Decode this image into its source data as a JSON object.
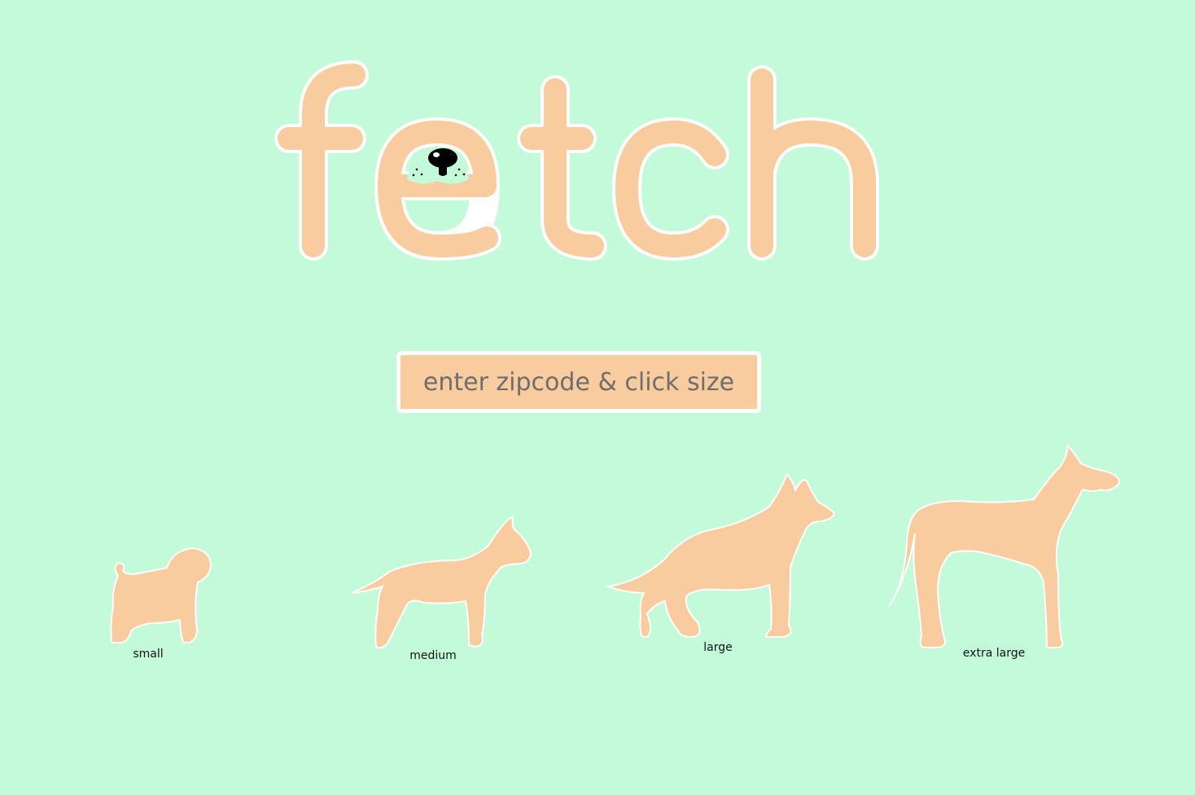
{
  "logo": {
    "text": "fetch",
    "fill_color": "#f8cc9e",
    "outline_color": "#ffffff",
    "nose_color": "#000000",
    "icon": "dog-nose-icon"
  },
  "search": {
    "placeholder": "enter zipcode & click size",
    "value": ""
  },
  "sizes": [
    {
      "id": "small",
      "label": "small",
      "icon": "small-dog-icon"
    },
    {
      "id": "medium",
      "label": "medium",
      "icon": "medium-dog-icon"
    },
    {
      "id": "large",
      "label": "large",
      "icon": "large-dog-icon"
    },
    {
      "id": "extra-large",
      "label": "extra large",
      "icon": "extra-large-dog-icon"
    }
  ],
  "colors": {
    "background": "#c3fbda",
    "accent": "#f8cc9e",
    "outline": "#ffffff",
    "label_text": "#111111",
    "placeholder_text": "#6e6e6e"
  }
}
